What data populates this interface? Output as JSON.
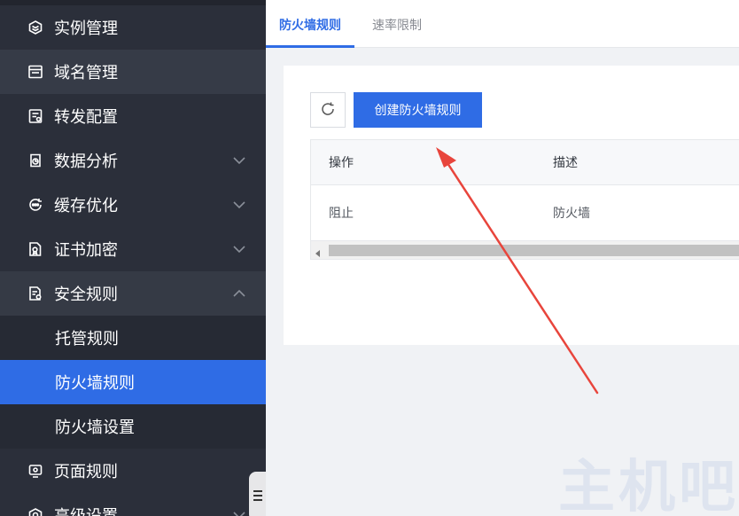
{
  "sidebar": {
    "items": [
      {
        "label": "实例管理",
        "icon": "layers-icon"
      },
      {
        "label": "域名管理",
        "icon": "window-icon"
      },
      {
        "label": "转发配置",
        "icon": "forward-config-icon"
      },
      {
        "label": "数据分析",
        "icon": "chart-icon"
      },
      {
        "label": "缓存优化",
        "icon": "cache-icon"
      },
      {
        "label": "证书加密",
        "icon": "certificate-icon"
      },
      {
        "label": "安全规则",
        "icon": "security-doc-icon"
      },
      {
        "label": "托管规则"
      },
      {
        "label": "防火墙规则"
      },
      {
        "label": "防火墙设置"
      },
      {
        "label": "页面规则",
        "icon": "page-rule-icon"
      },
      {
        "label": "高级设置",
        "icon": "advanced-icon"
      }
    ]
  },
  "tabs": [
    {
      "label": "防火墙规则",
      "active": true
    },
    {
      "label": "速率限制",
      "active": false
    }
  ],
  "toolbar": {
    "create_label": "创建防火墙规则"
  },
  "table": {
    "headers": [
      "操作",
      "描述"
    ],
    "rows": [
      [
        "阻止",
        "防火墙"
      ]
    ]
  },
  "watermark": "主机吧",
  "colors": {
    "accent": "#2f6ce5",
    "sidebar_bg": "#2b2f3a",
    "arrow": "#e8453c"
  }
}
